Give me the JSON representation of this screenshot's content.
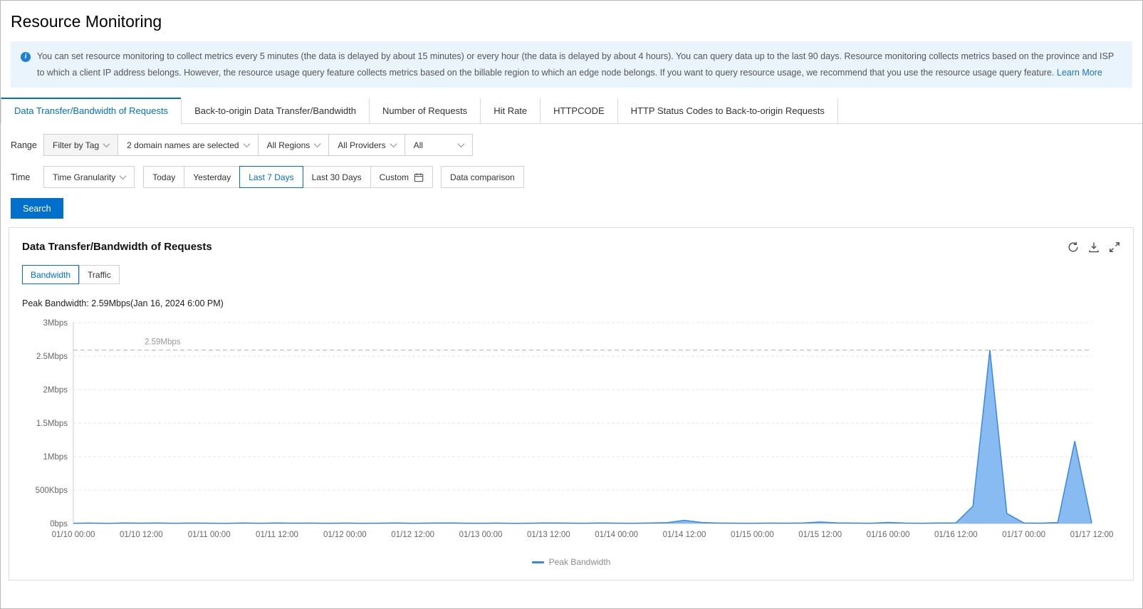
{
  "page": {
    "title": "Resource Monitoring"
  },
  "banner": {
    "text": "You can set resource monitoring to collect metrics every 5 minutes (the data is delayed by about 15 minutes) or every hour (the data is delayed by about 4 hours). You can query data up to the last 90 days. Resource monitoring collects metrics based on the province and ISP to which a client IP address belongs. However, the resource usage query feature collects metrics based on the billable region to which an edge node belongs. If you want to query resource usage, we recommend that you use the resource usage query feature.",
    "link": "Learn More"
  },
  "tabs": {
    "items": [
      {
        "label": "Data Transfer/Bandwidth of Requests",
        "active": true
      },
      {
        "label": "Back-to-origin Data Transfer/Bandwidth",
        "active": false
      },
      {
        "label": "Number of Requests",
        "active": false
      },
      {
        "label": "Hit Rate",
        "active": false
      },
      {
        "label": "HTTPCODE",
        "active": false
      },
      {
        "label": "HTTP Status Codes to Back-to-origin Requests",
        "active": false
      }
    ]
  },
  "filters": {
    "range_label": "Range",
    "filter_by_tag": "Filter by Tag",
    "domains": "2 domain names are selected",
    "regions": "All Regions",
    "providers": "All Providers",
    "all": "All",
    "time_label": "Time",
    "granularity": "Time Granularity",
    "today": "Today",
    "yesterday": "Yesterday",
    "last7": "Last 7 Days",
    "last30": "Last 30 Days",
    "custom": "Custom",
    "comparison": "Data comparison",
    "search": "Search"
  },
  "panel": {
    "title": "Data Transfer/Bandwidth of Requests",
    "toggle": {
      "bandwidth": "Bandwidth",
      "traffic": "Traffic"
    },
    "peak_text": "Peak Bandwidth: 2.59Mbps(Jan 16, 2024 6:00 PM)",
    "legend": "Peak Bandwidth"
  },
  "chart_data": {
    "type": "area",
    "title": "Data Transfer/Bandwidth of Requests",
    "series_name": "Peak Bandwidth",
    "unit": "Kbps",
    "ylim": [
      0,
      3000
    ],
    "grid": true,
    "legend_position": "bottom",
    "y_ticks": [
      {
        "value": 0,
        "label": "0bps"
      },
      {
        "value": 500,
        "label": "500Kbps"
      },
      {
        "value": 1000,
        "label": "1Mbps"
      },
      {
        "value": 1500,
        "label": "1.5Mbps"
      },
      {
        "value": 2000,
        "label": "2Mbps"
      },
      {
        "value": 2500,
        "label": "2.5Mbps"
      },
      {
        "value": 3000,
        "label": "3Mbps"
      }
    ],
    "x_tick_labels": [
      "01/10 00:00",
      "01/10 12:00",
      "01/11 00:00",
      "01/11 12:00",
      "01/12 00:00",
      "01/12 12:00",
      "01/13 00:00",
      "01/13 12:00",
      "01/14 00:00",
      "01/14 12:00",
      "01/15 00:00",
      "01/15 12:00",
      "01/16 00:00",
      "01/16 12:00",
      "01/17 00:00",
      "01/17 12:00"
    ],
    "peak_line": {
      "value": 2590,
      "label": "2.59Mbps"
    },
    "points": [
      [
        "01/10 00:00",
        4
      ],
      [
        "01/10 03:00",
        6
      ],
      [
        "01/10 06:00",
        3
      ],
      [
        "01/10 09:00",
        8
      ],
      [
        "01/10 12:00",
        5
      ],
      [
        "01/10 15:00",
        7
      ],
      [
        "01/10 18:00",
        4
      ],
      [
        "01/10 21:00",
        6
      ],
      [
        "01/11 00:00",
        5
      ],
      [
        "01/11 03:00",
        3
      ],
      [
        "01/11 06:00",
        7
      ],
      [
        "01/11 09:00",
        4
      ],
      [
        "01/11 12:00",
        8
      ],
      [
        "01/11 15:00",
        5
      ],
      [
        "01/11 18:00",
        6
      ],
      [
        "01/11 21:00",
        4
      ],
      [
        "01/12 00:00",
        6
      ],
      [
        "01/12 03:00",
        4
      ],
      [
        "01/12 06:00",
        5
      ],
      [
        "01/12 09:00",
        7
      ],
      [
        "01/12 12:00",
        4
      ],
      [
        "01/12 15:00",
        6
      ],
      [
        "01/12 18:00",
        8
      ],
      [
        "01/12 21:00",
        5
      ],
      [
        "01/13 00:00",
        4
      ],
      [
        "01/13 03:00",
        6
      ],
      [
        "01/13 06:00",
        3
      ],
      [
        "01/13 09:00",
        5
      ],
      [
        "01/13 12:00",
        9
      ],
      [
        "01/13 15:00",
        6
      ],
      [
        "01/13 18:00",
        4
      ],
      [
        "01/13 21:00",
        7
      ],
      [
        "01/14 00:00",
        5
      ],
      [
        "01/14 03:00",
        4
      ],
      [
        "01/14 06:00",
        8
      ],
      [
        "01/14 09:00",
        14
      ],
      [
        "01/14 12:00",
        48
      ],
      [
        "01/14 15:00",
        16
      ],
      [
        "01/14 18:00",
        6
      ],
      [
        "01/14 21:00",
        5
      ],
      [
        "01/15 00:00",
        4
      ],
      [
        "01/15 03:00",
        6
      ],
      [
        "01/15 06:00",
        5
      ],
      [
        "01/15 09:00",
        8
      ],
      [
        "01/15 12:00",
        22
      ],
      [
        "01/15 15:00",
        10
      ],
      [
        "01/15 18:00",
        6
      ],
      [
        "01/15 21:00",
        4
      ],
      [
        "01/16 00:00",
        16
      ],
      [
        "01/16 03:00",
        6
      ],
      [
        "01/16 06:00",
        4
      ],
      [
        "01/16 09:00",
        7
      ],
      [
        "01/16 12:00",
        10
      ],
      [
        "01/16 15:00",
        260
      ],
      [
        "01/16 18:00",
        2590
      ],
      [
        "01/16 21:00",
        150
      ],
      [
        "01/17 00:00",
        8
      ],
      [
        "01/17 03:00",
        5
      ],
      [
        "01/17 06:00",
        15
      ],
      [
        "01/17 09:00",
        1230
      ],
      [
        "01/17 12:00",
        6
      ]
    ],
    "colors": {
      "line": "#3a87e0",
      "fill": "#7ab4f0",
      "peak_line": "#b5b5b5"
    }
  }
}
